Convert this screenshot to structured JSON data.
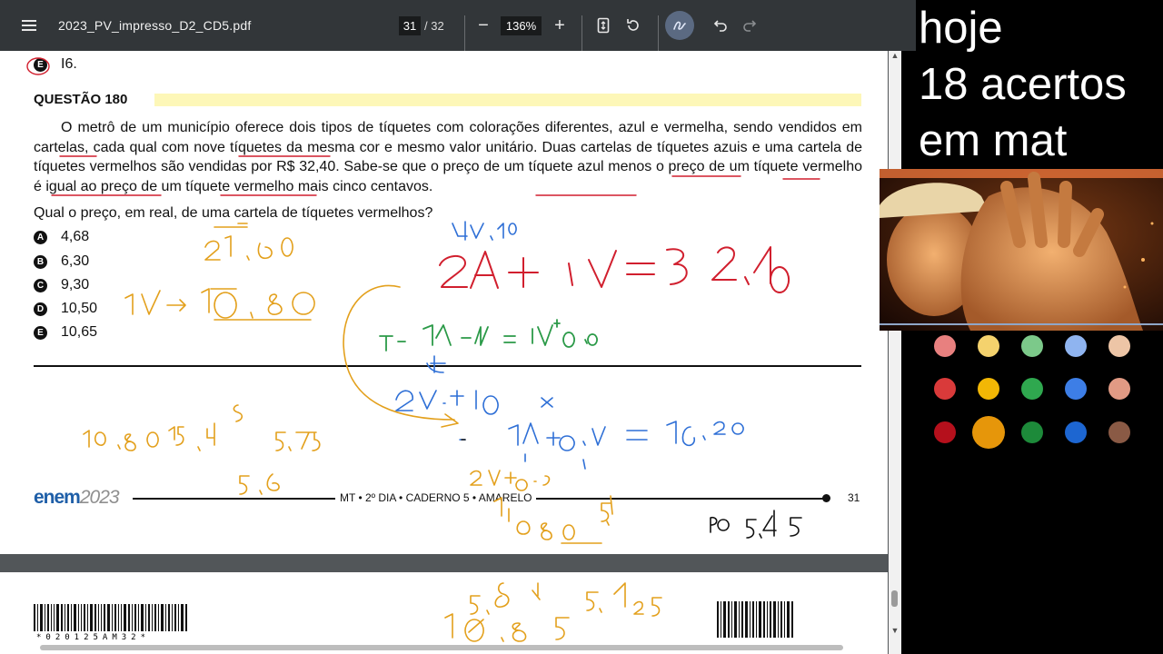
{
  "toolbar": {
    "file_name": "2023_PV_impresso_D2_CD5.pdf",
    "current_page": "31",
    "total_pages": "/ 32",
    "zoom": "136%",
    "icons": [
      "menu-icon",
      "zoom-out-icon",
      "zoom-in-icon",
      "fit-page-icon",
      "rotate-icon",
      "annotate-pen-icon",
      "undo-icon",
      "redo-icon"
    ]
  },
  "pdf": {
    "previous_option": {
      "letter": "E",
      "text": "I6."
    },
    "question_title": "QUESTÃO 180",
    "statement": "O metrô de um município oferece dois tipos de tíquetes com colorações diferentes, azul e vermelha, sendo vendidos em cartelas, cada qual com nove tíquetes da mesma cor e mesmo valor unitário. Duas cartelas de tíquetes azuis e uma cartela de tíquetes vermelhos são vendidas por R$ 32,40. Sabe-se que o preço de um tíquete azul menos o preço de um tíquete vermelho é igual ao preço de um tíquete vermelho mais cinco centavos.",
    "question": "Qual o preço, em real, de uma cartela de tíquetes vermelhos?",
    "options": [
      {
        "letter": "A",
        "text": "4,68"
      },
      {
        "letter": "B",
        "text": "6,30"
      },
      {
        "letter": "C",
        "text": "9,30"
      },
      {
        "letter": "D",
        "text": "10,50"
      },
      {
        "letter": "E",
        "text": "10,65"
      }
    ],
    "footer": {
      "logo": "enem",
      "logo_year": "2023",
      "caption": "MT • 2º DIA • CADERNO 5 • AMARELO",
      "page_number": "31"
    },
    "barcode_text": "*020125AM32*"
  },
  "handwriting": {
    "red": [
      "2A + 1V = 32,40"
    ],
    "blue": [
      "4V,10",
      "2V + 0,5",
      "1A + 0,5V = 16,20"
    ],
    "green": [
      "T = 1A - 1V = 1V + 0,05"
    ],
    "orange": [
      "21,60",
      "1V -> 10,80",
      "10,80 | 5,4",
      "5,5",
      "5,6",
      "2V + 0,5",
      "1080",
      "5,4",
      "5,85",
      "5,425",
      "10,85"
    ],
    "black": [
      "PO 5,45"
    ]
  },
  "overlay": {
    "lines": [
      "hoje",
      "18 acertos",
      "em mat"
    ]
  },
  "palette": {
    "colors": [
      "#e8807f",
      "#f4d26d",
      "#7cc98a",
      "#8fb4f0",
      "#edc5a6",
      "#d93a3a",
      "#f2b705",
      "#2fa84f",
      "#3d7ee6",
      "#e19a84",
      "#b5101c",
      "#e6960a",
      "#1d8a3a",
      "#1d66d1",
      "#8a5a45"
    ],
    "selected": "#e6960a"
  }
}
